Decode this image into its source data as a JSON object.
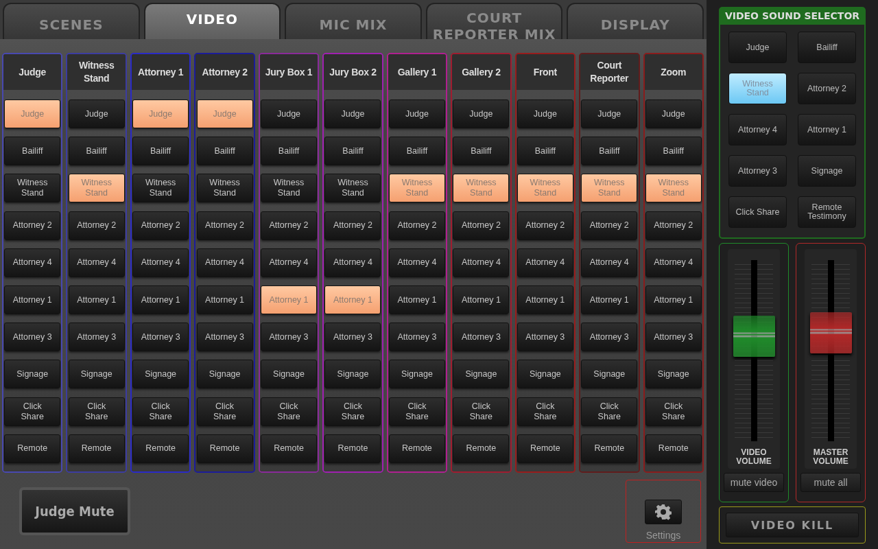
{
  "tabs": [
    {
      "label": "SCENES",
      "selected": false
    },
    {
      "label": "VIDEO",
      "selected": true
    },
    {
      "label": "MIC MIX",
      "selected": false
    },
    {
      "label": "COURT REPORTER MIX",
      "selected": false
    },
    {
      "label": "DISPLAY",
      "selected": false
    }
  ],
  "columns": [
    {
      "title": "Judge",
      "color": "#4848b0",
      "buttons": [
        {
          "label": "Judge",
          "selected": true
        },
        {
          "label": "Bailiff",
          "selected": false
        },
        {
          "label": "Witness Stand",
          "selected": false
        },
        {
          "label": "Attorney 2",
          "selected": false
        },
        {
          "label": "Attorney 4",
          "selected": false
        },
        {
          "label": "Attorney 1",
          "selected": false
        },
        {
          "label": "Attorney 3",
          "selected": false
        },
        {
          "label": "Signage",
          "selected": false
        },
        {
          "label": "Click Share",
          "selected": false
        },
        {
          "label": "Remote",
          "selected": false
        }
      ]
    },
    {
      "title": "Witness Stand",
      "color": "#3c3ca0",
      "buttons": [
        {
          "label": "Judge",
          "selected": false
        },
        {
          "label": "Bailiff",
          "selected": false
        },
        {
          "label": "Witness Stand",
          "selected": true
        },
        {
          "label": "Attorney 2",
          "selected": false
        },
        {
          "label": "Attorney 4",
          "selected": false
        },
        {
          "label": "Attorney 1",
          "selected": false
        },
        {
          "label": "Attorney 3",
          "selected": false
        },
        {
          "label": "Signage",
          "selected": false
        },
        {
          "label": "Click Share",
          "selected": false
        },
        {
          "label": "Remote",
          "selected": false
        }
      ]
    },
    {
      "title": "Attorney 1",
      "color": "#2a2ac8",
      "buttons": [
        {
          "label": "Judge",
          "selected": true
        },
        {
          "label": "Bailiff",
          "selected": false
        },
        {
          "label": "Witness Stand",
          "selected": false
        },
        {
          "label": "Attorney 2",
          "selected": false
        },
        {
          "label": "Attorney 4",
          "selected": false
        },
        {
          "label": "Attorney 1",
          "selected": false
        },
        {
          "label": "Attorney 3",
          "selected": false
        },
        {
          "label": "Signage",
          "selected": false
        },
        {
          "label": "Click Share",
          "selected": false
        },
        {
          "label": "Remote",
          "selected": false
        }
      ]
    },
    {
      "title": "Attorney 2",
      "color": "#1c1c9a",
      "buttons": [
        {
          "label": "Judge",
          "selected": true
        },
        {
          "label": "Bailiff",
          "selected": false
        },
        {
          "label": "Witness Stand",
          "selected": false
        },
        {
          "label": "Attorney 2",
          "selected": false
        },
        {
          "label": "Attorney 4",
          "selected": false
        },
        {
          "label": "Attorney 1",
          "selected": false
        },
        {
          "label": "Attorney 3",
          "selected": false
        },
        {
          "label": "Signage",
          "selected": false
        },
        {
          "label": "Click Share",
          "selected": false
        },
        {
          "label": "Remote",
          "selected": false
        }
      ]
    },
    {
      "title": "Jury Box 1",
      "color": "#8a2a9a",
      "buttons": [
        {
          "label": "Judge",
          "selected": false
        },
        {
          "label": "Bailiff",
          "selected": false
        },
        {
          "label": "Witness Stand",
          "selected": false
        },
        {
          "label": "Attorney 2",
          "selected": false
        },
        {
          "label": "Attorney 4",
          "selected": false
        },
        {
          "label": "Attorney 1",
          "selected": true
        },
        {
          "label": "Attorney 3",
          "selected": false
        },
        {
          "label": "Signage",
          "selected": false
        },
        {
          "label": "Click Share",
          "selected": false
        },
        {
          "label": "Remote",
          "selected": false
        }
      ]
    },
    {
      "title": "Jury Box 2",
      "color": "#a020b0",
      "buttons": [
        {
          "label": "Judge",
          "selected": false
        },
        {
          "label": "Bailiff",
          "selected": false
        },
        {
          "label": "Witness Stand",
          "selected": false
        },
        {
          "label": "Attorney 2",
          "selected": false
        },
        {
          "label": "Attorney 4",
          "selected": false
        },
        {
          "label": "Attorney 1",
          "selected": true
        },
        {
          "label": "Attorney 3",
          "selected": false
        },
        {
          "label": "Signage",
          "selected": false
        },
        {
          "label": "Click Share",
          "selected": false
        },
        {
          "label": "Remote",
          "selected": false
        }
      ]
    },
    {
      "title": "Gallery 1",
      "color": "#b02090",
      "buttons": [
        {
          "label": "Judge",
          "selected": false
        },
        {
          "label": "Bailiff",
          "selected": false
        },
        {
          "label": "Witness Stand",
          "selected": true
        },
        {
          "label": "Attorney 2",
          "selected": false
        },
        {
          "label": "Attorney 4",
          "selected": false
        },
        {
          "label": "Attorney 1",
          "selected": false
        },
        {
          "label": "Attorney 3",
          "selected": false
        },
        {
          "label": "Signage",
          "selected": false
        },
        {
          "label": "Click Share",
          "selected": false
        },
        {
          "label": "Remote",
          "selected": false
        }
      ]
    },
    {
      "title": "Gallery 2",
      "color": "#a01c30",
      "buttons": [
        {
          "label": "Judge",
          "selected": false
        },
        {
          "label": "Bailiff",
          "selected": false
        },
        {
          "label": "Witness Stand",
          "selected": true
        },
        {
          "label": "Attorney 2",
          "selected": false
        },
        {
          "label": "Attorney 4",
          "selected": false
        },
        {
          "label": "Attorney 1",
          "selected": false
        },
        {
          "label": "Attorney 3",
          "selected": false
        },
        {
          "label": "Signage",
          "selected": false
        },
        {
          "label": "Click Share",
          "selected": false
        },
        {
          "label": "Remote",
          "selected": false
        }
      ]
    },
    {
      "title": "Front",
      "color": "#981c1c",
      "buttons": [
        {
          "label": "Judge",
          "selected": false
        },
        {
          "label": "Bailiff",
          "selected": false
        },
        {
          "label": "Witness Stand",
          "selected": true
        },
        {
          "label": "Attorney 2",
          "selected": false
        },
        {
          "label": "Attorney 4",
          "selected": false
        },
        {
          "label": "Attorney 1",
          "selected": false
        },
        {
          "label": "Attorney 3",
          "selected": false
        },
        {
          "label": "Signage",
          "selected": false
        },
        {
          "label": "Click Share",
          "selected": false
        },
        {
          "label": "Remote",
          "selected": false
        }
      ]
    },
    {
      "title": "Court Reporter",
      "color": "#601c1c",
      "buttons": [
        {
          "label": "Judge",
          "selected": false
        },
        {
          "label": "Bailiff",
          "selected": false
        },
        {
          "label": "Witness Stand",
          "selected": true
        },
        {
          "label": "Attorney 2",
          "selected": false
        },
        {
          "label": "Attorney 4",
          "selected": false
        },
        {
          "label": "Attorney 1",
          "selected": false
        },
        {
          "label": "Attorney 3",
          "selected": false
        },
        {
          "label": "Signage",
          "selected": false
        },
        {
          "label": "Click Share",
          "selected": false
        },
        {
          "label": "Remote",
          "selected": false
        }
      ]
    },
    {
      "title": "Zoom",
      "color": "#8a1c1c",
      "buttons": [
        {
          "label": "Judge",
          "selected": false
        },
        {
          "label": "Bailiff",
          "selected": false
        },
        {
          "label": "Witness Stand",
          "selected": true
        },
        {
          "label": "Attorney 2",
          "selected": false
        },
        {
          "label": "Attorney 4",
          "selected": false
        },
        {
          "label": "Attorney 1",
          "selected": false
        },
        {
          "label": "Attorney 3",
          "selected": false
        },
        {
          "label": "Signage",
          "selected": false
        },
        {
          "label": "Click Share",
          "selected": false
        },
        {
          "label": "Remote",
          "selected": false
        }
      ]
    }
  ],
  "judge_mute": "Judge Mute",
  "settings": {
    "label": "Settings"
  },
  "sound_selector": {
    "title": "VIDEO SOUND SELECTOR",
    "buttons": [
      {
        "label": "Judge",
        "selected": false
      },
      {
        "label": "Bailiff",
        "selected": false
      },
      {
        "label": "Witness Stand",
        "selected": true
      },
      {
        "label": "Attorney 2",
        "selected": false
      },
      {
        "label": "Attorney 4",
        "selected": false
      },
      {
        "label": "Attorney 1",
        "selected": false
      },
      {
        "label": "Attorney 3",
        "selected": false
      },
      {
        "label": "Signage",
        "selected": false
      },
      {
        "label": "Click Share",
        "selected": false
      },
      {
        "label": "Remote Testimony",
        "selected": false
      }
    ]
  },
  "faders": [
    {
      "label": "VIDEO VOLUME",
      "color": "#1f8a2a",
      "level": 0.58,
      "mute": "mute video"
    },
    {
      "label": "MASTER VOLUME",
      "color": "#b02828",
      "level": 0.6,
      "mute": "mute all"
    }
  ],
  "video_kill": "VIDEO KILL"
}
